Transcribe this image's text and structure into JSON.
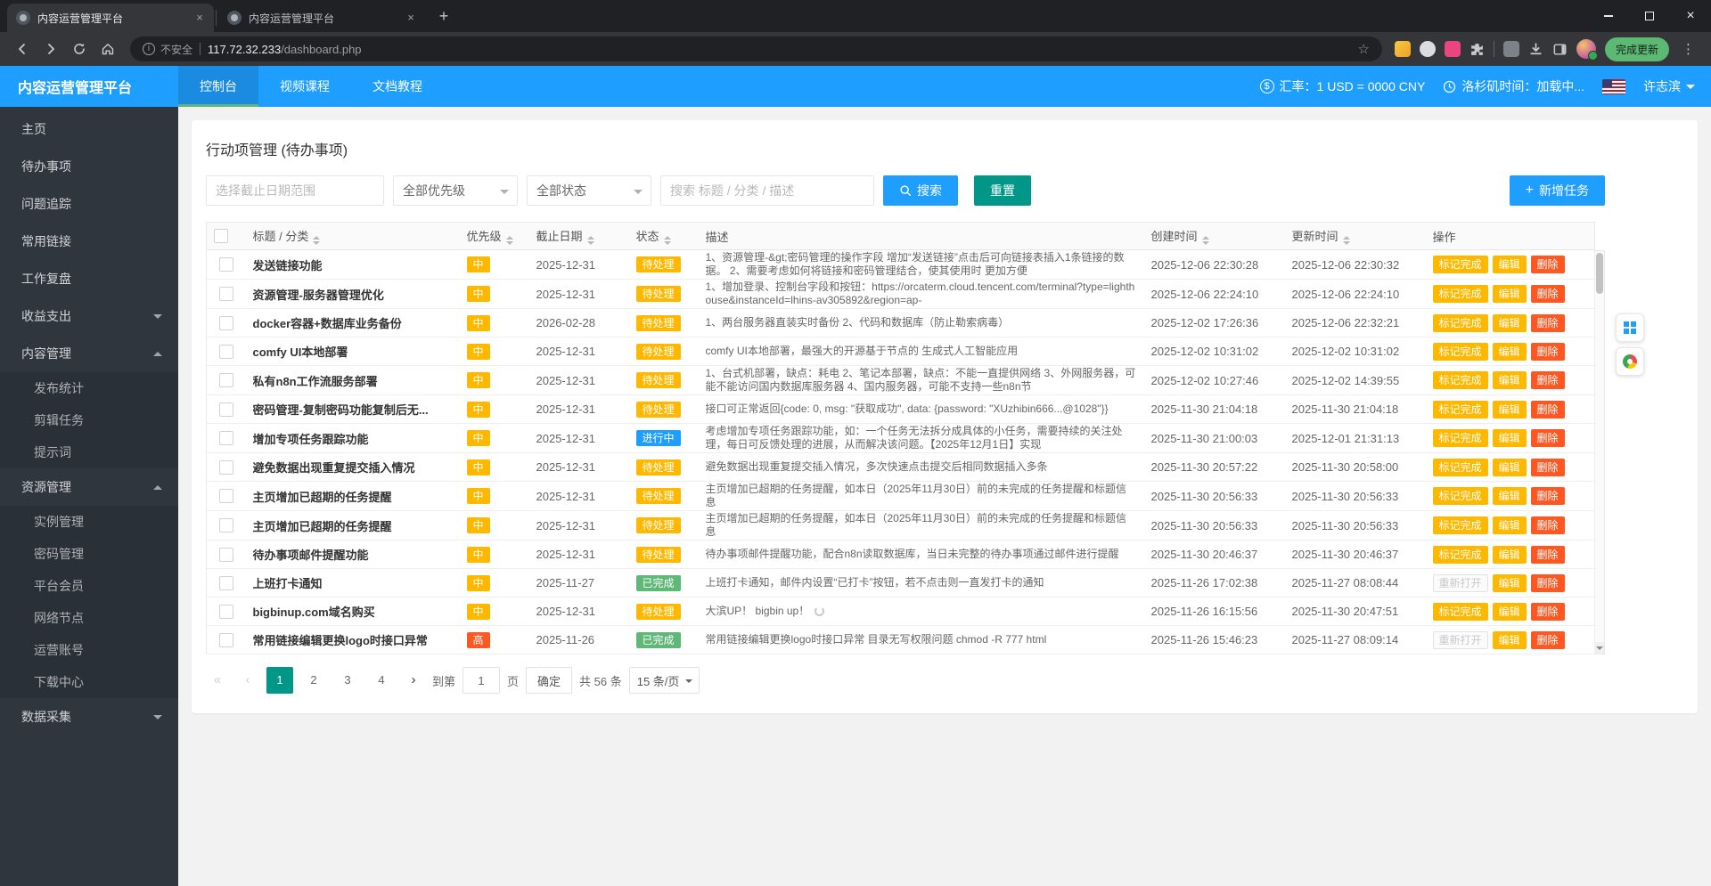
{
  "colors": {
    "primary": "#1E9FFF",
    "success": "#5FB878",
    "warning": "#FFB800",
    "danger": "#FF5722",
    "reset_green": "#009688",
    "sidebar_bg": "#2F363E",
    "update_pill_green": "#5bb974"
  },
  "browser": {
    "tabs": [
      {
        "title": "内容运营管理平台"
      },
      {
        "title": "内容运营管理平台"
      }
    ],
    "security_label": "不安全",
    "url_host": "117.72.32.233",
    "url_path": "/dashboard.php",
    "update_button": "完成更新"
  },
  "header": {
    "brand": "内容运营管理平台",
    "nav": [
      {
        "label": "控制台",
        "active": true
      },
      {
        "label": "视频课程",
        "active": false
      },
      {
        "label": "文档教程",
        "active": false
      }
    ],
    "exchange_rate": "汇率：1 USD = 0000 CNY",
    "la_time": "洛杉矶时间：加载中...",
    "username": "许志滨"
  },
  "sidebar": {
    "items": [
      {
        "label": "主页"
      },
      {
        "label": "待办事项"
      },
      {
        "label": "问题追踪"
      },
      {
        "label": "常用链接"
      },
      {
        "label": "工作复盘"
      },
      {
        "label": "收益支出",
        "chevron": "down"
      },
      {
        "label": "内容管理",
        "chevron": "up",
        "children": [
          "发布统计",
          "剪辑任务",
          "提示词"
        ]
      },
      {
        "label": "资源管理",
        "chevron": "up",
        "children": [
          "实例管理",
          "密码管理",
          "平台会员",
          "网络节点",
          "运营账号",
          "下载中心"
        ]
      },
      {
        "label": "数据采集",
        "chevron": "down"
      }
    ]
  },
  "main": {
    "title": "行动项管理 (待办事项)",
    "filters": {
      "date_placeholder": "选择截止日期范围",
      "priority_value": "全部优先级",
      "status_value": "全部状态",
      "search_placeholder": "搜索 标题 / 分类 / 描述",
      "search_btn": "搜索",
      "reset_btn": "重置",
      "add_btn": "新增任务"
    },
    "table": {
      "columns": [
        "标题 / 分类",
        "优先级",
        "截止日期",
        "状态",
        "描述",
        "创建时间",
        "更新时间",
        "操作"
      ],
      "sortable": [
        true,
        true,
        true,
        true,
        false,
        true,
        true,
        false
      ],
      "action_labels": {
        "mark_done": "标记完成",
        "reopen": "重新打开",
        "edit": "编辑",
        "delete": "删除"
      },
      "rows": [
        {
          "title": "发送链接功能",
          "priority": {
            "label": "中",
            "level": "mid"
          },
          "due": "2025-12-31",
          "status": {
            "label": "待处理",
            "type": "pending"
          },
          "desc": "1、资源管理-&gt;密码管理的操作字段 增加“发送链接”点击后可向链接表插入1条链接的数据。 2、需要考虑如何将链接和密码管理结合，使其使用时 更加方便",
          "created": "2025-12-06 22:30:28",
          "updated": "2025-12-06 22:30:32",
          "done": false
        },
        {
          "title": "资源管理-服务器管理优化",
          "priority": {
            "label": "中",
            "level": "mid"
          },
          "due": "2025-12-31",
          "status": {
            "label": "待处理",
            "type": "pending"
          },
          "desc": "1、增加登录、控制台字段和按钮：https://orcaterm.cloud.tencent.com/terminal?type=lighthouse&instanceId=lhins-av305892&region=ap-",
          "created": "2025-12-06 22:24:10",
          "updated": "2025-12-06 22:24:10",
          "done": false
        },
        {
          "title": "docker容器+数据库业务备份",
          "priority": {
            "label": "中",
            "level": "mid"
          },
          "due": "2026-02-28",
          "status": {
            "label": "待处理",
            "type": "pending"
          },
          "desc": "1、两台服务器直装实时备份 2、代码和数据库（防止勒索病毒）",
          "created": "2025-12-02 17:26:36",
          "updated": "2025-12-06 22:32:21",
          "done": false
        },
        {
          "title": "comfy UI本地部署",
          "priority": {
            "label": "中",
            "level": "mid"
          },
          "due": "2025-12-31",
          "status": {
            "label": "待处理",
            "type": "pending"
          },
          "desc": "comfy UI本地部署，最强大的开源基于节点的 生成式人工智能应用",
          "created": "2025-12-02 10:31:02",
          "updated": "2025-12-02 10:31:02",
          "done": false
        },
        {
          "title": "私有n8n工作流服务部署",
          "priority": {
            "label": "中",
            "level": "mid"
          },
          "due": "2025-12-31",
          "status": {
            "label": "待处理",
            "type": "pending"
          },
          "desc": "1、台式机部署，缺点：耗电 2、笔记本部署，缺点：不能一直提供网络 3、外网服务器，可能不能访问国内数据库服务器 4、国内服务器，可能不支持一些n8n节",
          "created": "2025-12-02 10:27:46",
          "updated": "2025-12-02 14:39:55",
          "done": false
        },
        {
          "title": "密码管理-复制密码功能复制后无...",
          "priority": {
            "label": "中",
            "level": "mid"
          },
          "due": "2025-12-31",
          "status": {
            "label": "待处理",
            "type": "pending"
          },
          "desc": "接口可正常返回{code: 0, msg: \"获取成功\", data: {password: \"XUzhibin666...@1028\"}}",
          "created": "2025-11-30 21:04:18",
          "updated": "2025-11-30 21:04:18",
          "done": false
        },
        {
          "title": "增加专项任务跟踪功能",
          "priority": {
            "label": "中",
            "level": "mid"
          },
          "due": "2025-12-31",
          "status": {
            "label": "进行中",
            "type": "doing"
          },
          "desc": "考虑增加专项任务跟踪功能，如：一个任务无法拆分成具体的小任务，需要持续的关注处理，每日可反馈处理的进展，从而解决该问题。【2025年12月1日】实现",
          "created": "2025-11-30 21:00:03",
          "updated": "2025-12-01 21:31:13",
          "done": false
        },
        {
          "title": "避免数据出现重复提交插入情况",
          "priority": {
            "label": "中",
            "level": "mid"
          },
          "due": "2025-12-31",
          "status": {
            "label": "待处理",
            "type": "pending"
          },
          "desc": "避免数据出现重复提交插入情况，多次快速点击提交后相同数据插入多条",
          "created": "2025-11-30 20:57:22",
          "updated": "2025-11-30 20:58:00",
          "done": false
        },
        {
          "title": "主页增加已超期的任务提醒",
          "priority": {
            "label": "中",
            "level": "mid"
          },
          "due": "2025-12-31",
          "status": {
            "label": "待处理",
            "type": "pending"
          },
          "desc": "主页增加已超期的任务提醒，如本日（2025年11月30日）前的未完成的任务提醒和标题信息",
          "created": "2025-11-30 20:56:33",
          "updated": "2025-11-30 20:56:33",
          "done": false
        },
        {
          "title": "主页增加已超期的任务提醒",
          "priority": {
            "label": "中",
            "level": "mid"
          },
          "due": "2025-12-31",
          "status": {
            "label": "待处理",
            "type": "pending"
          },
          "desc": "主页增加已超期的任务提醒，如本日（2025年11月30日）前的未完成的任务提醒和标题信息",
          "created": "2025-11-30 20:56:33",
          "updated": "2025-11-30 20:56:33",
          "done": false
        },
        {
          "title": "待办事项邮件提醒功能",
          "priority": {
            "label": "中",
            "level": "mid"
          },
          "due": "2025-12-31",
          "status": {
            "label": "待处理",
            "type": "pending"
          },
          "desc": "待办事项邮件提醒功能，配合n8n读取数据库，当日未完整的待办事项通过邮件进行提醒",
          "created": "2025-11-30 20:46:37",
          "updated": "2025-11-30 20:46:37",
          "done": false
        },
        {
          "title": "上班打卡通知",
          "priority": {
            "label": "中",
            "level": "mid"
          },
          "due": "2025-11-27",
          "status": {
            "label": "已完成",
            "type": "done"
          },
          "desc": "上班打卡通知，邮件内设置“已打卡”按钮，若不点击则一直发打卡的通知",
          "created": "2025-11-26 17:02:38",
          "updated": "2025-11-27 08:08:44",
          "done": true
        },
        {
          "title": "bigbinup.com域名购买",
          "priority": {
            "label": "中",
            "level": "mid"
          },
          "due": "2025-12-31",
          "status": {
            "label": "待处理",
            "type": "pending"
          },
          "desc": "大滨UP！ bigbin up！",
          "loading": true,
          "created": "2025-11-26 16:15:56",
          "updated": "2025-11-30 20:47:51",
          "done": false
        },
        {
          "title": "常用链接编辑更换logo时接口异常",
          "priority": {
            "label": "高",
            "level": "high"
          },
          "due": "2025-11-26",
          "status": {
            "label": "已完成",
            "type": "done"
          },
          "desc": "常用链接编辑更换logo时接口异常 目录无写权限问题 chmod -R 777 html",
          "created": "2025-11-26 15:46:23",
          "updated": "2025-11-27 08:09:14",
          "done": true
        }
      ]
    },
    "pagination": {
      "pages": [
        1,
        2,
        3,
        4
      ],
      "active": 1,
      "jump_label": "到第",
      "jump_value": "1",
      "page_suffix": "页",
      "confirm": "确定",
      "total": "共 56 条",
      "page_size": "15 条/页"
    }
  }
}
